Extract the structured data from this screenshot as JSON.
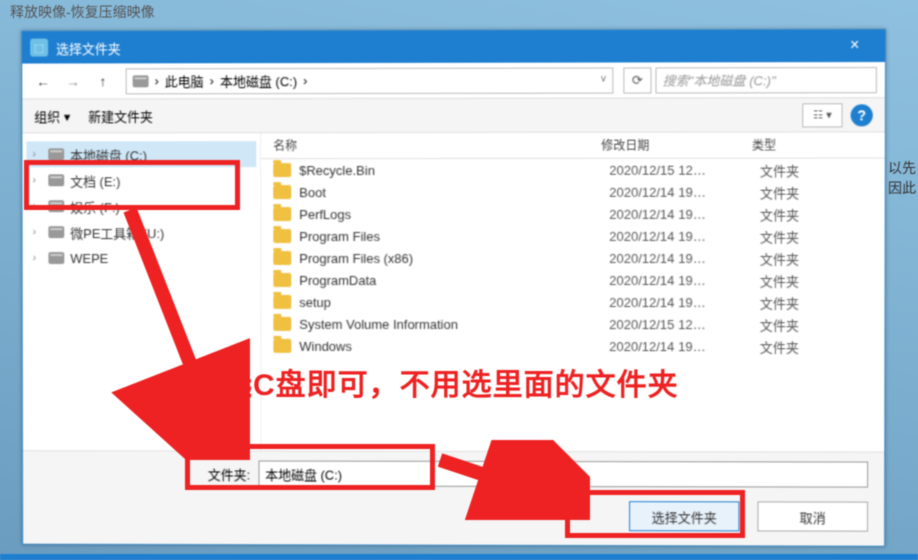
{
  "outer_title": "释放映像-恢复压缩映像",
  "side_text_1": "以先",
  "side_text_2": "因此",
  "dialog": {
    "title": "选择文件夹",
    "close_label": "×",
    "nav": {
      "breadcrumb_root": "此电脑",
      "breadcrumb_drive": "本地磁盘 (C:)",
      "search_placeholder": "搜索\"本地磁盘 (C:)\""
    },
    "toolbar": {
      "organize": "组织",
      "new_folder": "新建文件夹"
    },
    "sidebar": {
      "items": [
        {
          "label": "本地磁盘 (C:)",
          "selected": true
        },
        {
          "label": "文档 (E:)"
        },
        {
          "label": "娱乐 (F:)"
        },
        {
          "label": "微PE工具箱 (U:)"
        },
        {
          "label": "WEPE"
        }
      ]
    },
    "columns": {
      "name": "名称",
      "date": "修改日期",
      "type": "类型"
    },
    "files": [
      {
        "name": "$Recycle.Bin",
        "date": "2020/12/15 12…",
        "type": "文件夹"
      },
      {
        "name": "Boot",
        "date": "2020/12/14 19…",
        "type": "文件夹"
      },
      {
        "name": "PerfLogs",
        "date": "2020/12/14 19…",
        "type": "文件夹"
      },
      {
        "name": "Program Files",
        "date": "2020/12/14 19…",
        "type": "文件夹"
      },
      {
        "name": "Program Files (x86)",
        "date": "2020/12/14 19…",
        "type": "文件夹"
      },
      {
        "name": "ProgramData",
        "date": "2020/12/14 19…",
        "type": "文件夹"
      },
      {
        "name": "setup",
        "date": "2020/12/14 19…",
        "type": "文件夹"
      },
      {
        "name": "System Volume Information",
        "date": "2020/12/15 12…",
        "type": "文件夹"
      },
      {
        "name": "Windows",
        "date": "2020/12/14 19…",
        "type": "文件夹"
      }
    ],
    "footer": {
      "folder_label": "文件夹:",
      "folder_value": "本地磁盘 (C:)",
      "select_btn": "选择文件夹",
      "cancel_btn": "取消"
    }
  },
  "annotation": {
    "text": "选C盘即可，不用选里面的文件夹"
  }
}
